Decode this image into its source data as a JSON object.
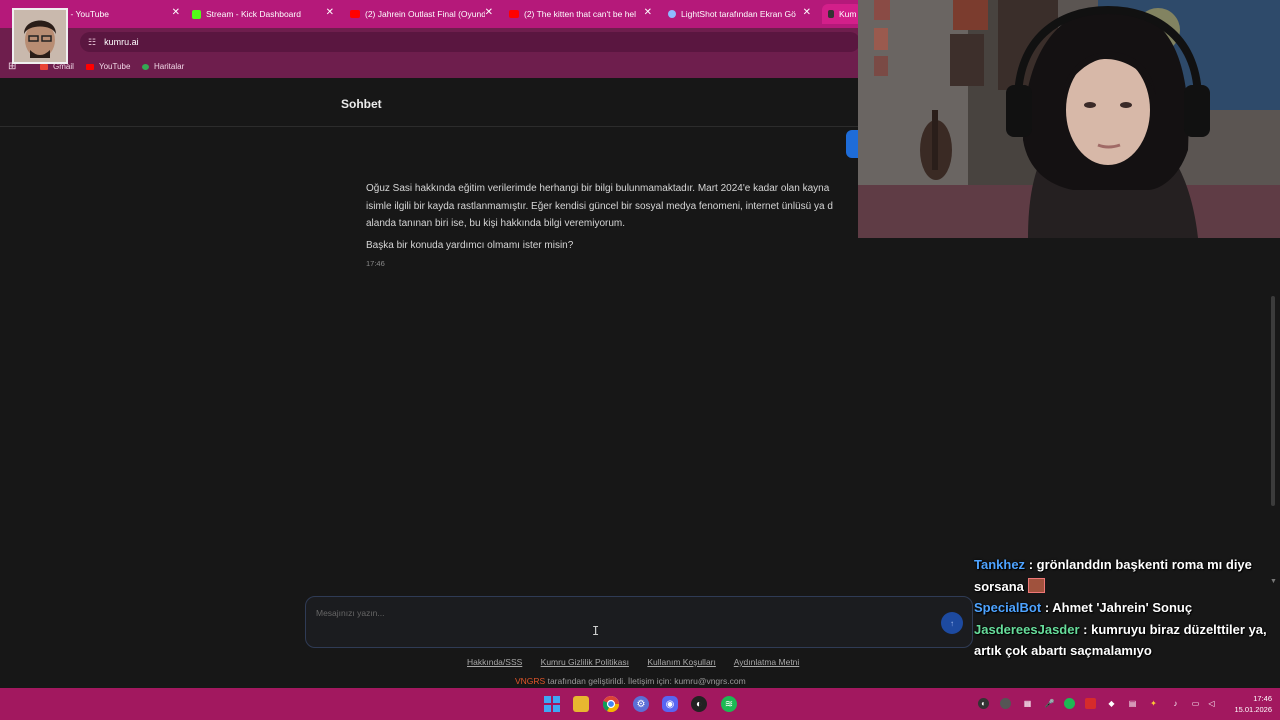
{
  "browser": {
    "tabs": [
      {
        "title": "...iberl - YouTube",
        "icon": "youtube-icon"
      },
      {
        "title": "Stream - Kick Dashboard",
        "icon": "kick-icon"
      },
      {
        "title": "(2) Jahrein Outlast Final (Oyund",
        "icon": "youtube-icon"
      },
      {
        "title": "(2) The kitten that can't be help",
        "icon": "youtube-icon"
      },
      {
        "title": "LightShot tarafından Ekran Gör",
        "icon": "lightshot-icon"
      },
      {
        "title": "Kum",
        "icon": "kumru-icon"
      }
    ],
    "url": "kumru.ai",
    "bookmarks": [
      "Gmail",
      "YouTube",
      "Haritalar"
    ]
  },
  "app": {
    "title": "Sohbet",
    "message": {
      "lines": [
        "Oğuz Sasi hakkında eğitim verilerimde herhangi bir bilgi bulunmamaktadır. Mart 2024'e kadar olan kayna",
        "isimle ilgili bir kayda rastlanmamıştır. Eğer kendisi güncel bir sosyal medya fenomeni, internet ünlüsü ya d",
        "alanda tanınan biri ise, bu kişi hakkında bilgi veremiyorum."
      ],
      "question": "Başka bir konuda yardımcı olmamı ister misin?",
      "time": "17:46"
    },
    "composer": {
      "placeholder": "Mesajınızı yazın...",
      "send_label": "↑"
    },
    "footer": {
      "links": [
        "Hakkında/SSS",
        "Kumru Gizlilik Politikası",
        "Kullanım Koşulları",
        "Aydınlatma Metni"
      ],
      "brand": "VNGRS",
      "credit": " tarafından geliştirildi. İletişim için: kumru@vngrs.com"
    }
  },
  "chat": [
    {
      "user": "Tankhez",
      "text": ": grönlanddın başkenti roma mı diye sorsana",
      "emote": true
    },
    {
      "user": "SpecialBot",
      "text": ": Ahmet 'Jahrein' Sonuç"
    },
    {
      "user": "JasdereesJasder",
      "text": ": kumruyu biraz düzelttiler ya, artık çok abartı saçmalamıyo"
    }
  ],
  "clock": {
    "time": "17:46",
    "date": "15.01.2026"
  },
  "colors": {
    "tab_bar": "#b5197a",
    "toolbar": "#6e1e4d",
    "taskbar": "#a2185f",
    "chat_user": "#4ea3ff",
    "chat_user_alt": "#67dd9b",
    "brand": "#e0562a"
  }
}
